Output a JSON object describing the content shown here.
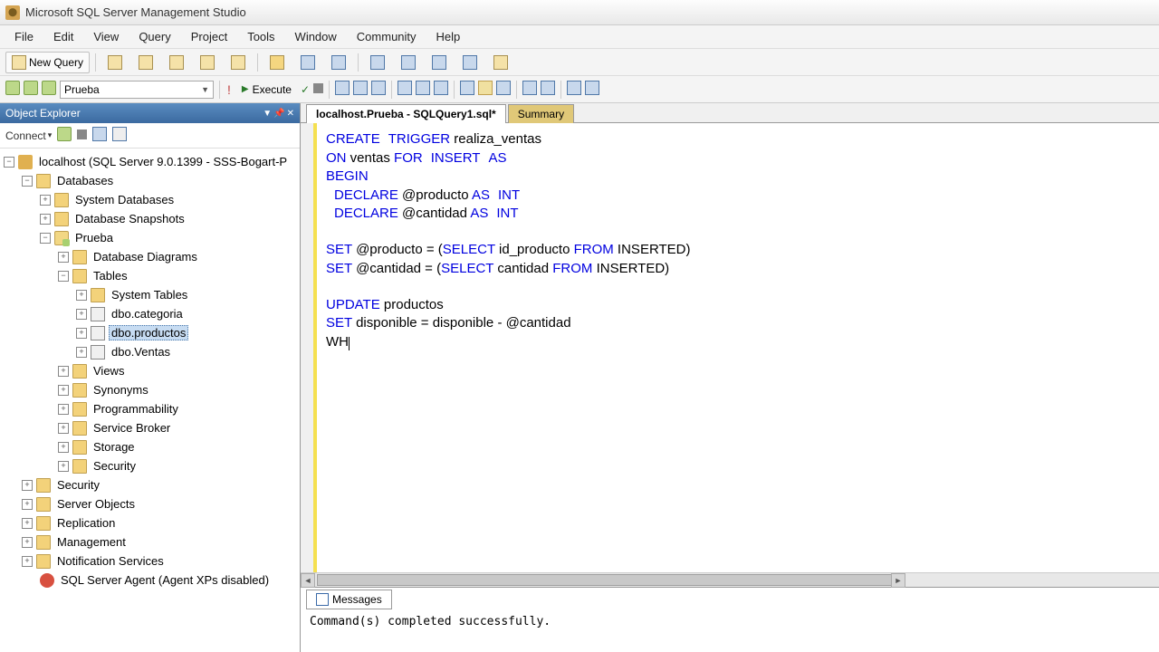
{
  "app": {
    "title": "Microsoft SQL Server Management Studio"
  },
  "menu": {
    "file": "File",
    "edit": "Edit",
    "view": "View",
    "query": "Query",
    "project": "Project",
    "tools": "Tools",
    "window": "Window",
    "community": "Community",
    "help": "Help"
  },
  "toolbar": {
    "new_query": "New Query"
  },
  "db_selector": {
    "value": "Prueba"
  },
  "execute_label": "Execute",
  "explorer": {
    "title": "Object Explorer",
    "connect": "Connect",
    "server": "localhost (SQL Server 9.0.1399 - SSS-Bogart-P",
    "databases": "Databases",
    "system_databases": "System Databases",
    "snapshots": "Database Snapshots",
    "prueba": "Prueba",
    "diagrams": "Database Diagrams",
    "tables": "Tables",
    "system_tables": "System Tables",
    "tbl_categoria": "dbo.categoria",
    "tbl_productos": "dbo.productos",
    "tbl_ventas": "dbo.Ventas",
    "views": "Views",
    "synonyms": "Synonyms",
    "programmability": "Programmability",
    "service_broker": "Service Broker",
    "storage": "Storage",
    "security_node": "Security",
    "security": "Security",
    "server_objects": "Server Objects",
    "replication": "Replication",
    "management": "Management",
    "notification": "Notification Services",
    "agent": "SQL Server Agent (Agent XPs disabled)"
  },
  "tabs": {
    "active": "localhost.Prueba - SQLQuery1.sql*",
    "summary": "Summary"
  },
  "sql": {
    "l1_kw1": "CREATE",
    "l1_kw2": "TRIGGER",
    "l1_rest": " realiza_ventas",
    "l2_kw1": "ON",
    "l2_txt": " ventas ",
    "l2_kw2": "FOR",
    "l2_kw3": "INSERT",
    "l2_kw4": "AS",
    "l3_kw": "BEGIN",
    "l4_kw": "DECLARE",
    "l4_txt": " @producto ",
    "l4_kw2": "AS",
    "l4_kw3": "INT",
    "l5_kw": "DECLARE",
    "l5_txt": " @cantidad ",
    "l5_kw2": "AS",
    "l5_kw3": "INT",
    "l7_kw": "SET",
    "l7_txt": " @producto = (",
    "l7_kw2": "SELECT",
    "l7_txt2": " id_producto ",
    "l7_kw3": "FROM",
    "l7_txt3": " INSERTED)",
    "l8_kw": "SET",
    "l8_txt": " @cantidad = (",
    "l8_kw2": "SELECT",
    "l8_txt2": " cantidad ",
    "l8_kw3": "FROM",
    "l8_txt3": " INSERTED)",
    "l10_kw": "UPDATE",
    "l10_txt": " productos",
    "l11_kw": "SET",
    "l11_txt": " disponible = disponible - @cantidad",
    "l12_txt": "WH"
  },
  "messages": {
    "tab": "Messages",
    "text": "Command(s) completed successfully."
  }
}
